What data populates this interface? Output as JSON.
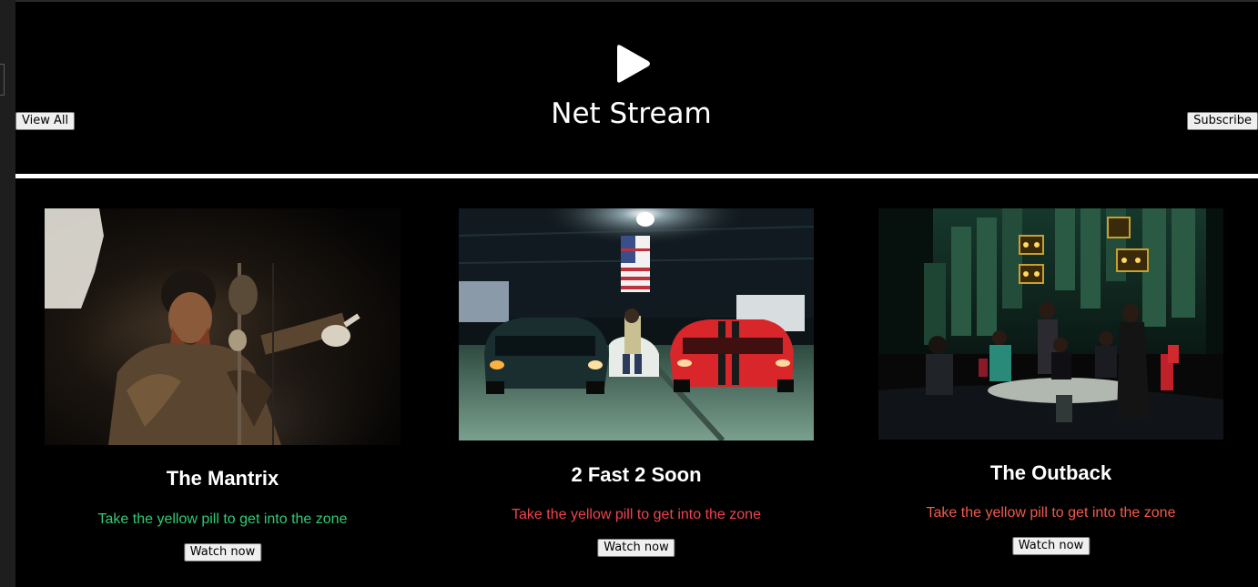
{
  "header": {
    "title": "Net Stream",
    "view_all_label": "View All",
    "subscribe_label": "Subscribe",
    "logo_icon": "play-icon"
  },
  "colors": {
    "background": "#000000",
    "text": "#ffffff",
    "desc_green": "#2ecc71",
    "desc_red": "#f0434f",
    "desc_orange": "#f05a4a"
  },
  "movies": [
    {
      "title": "The Mantrix",
      "description": "Take the yellow pill to get into the zone",
      "button_label": "Watch now",
      "desc_color": "#2ecc71"
    },
    {
      "title": "2 Fast 2 Soon",
      "description": "Take the yellow pill to get into the zone",
      "button_label": "Watch now",
      "desc_color": "#f0434f"
    },
    {
      "title": "The Outback",
      "description": "Take the yellow pill to get into the zone",
      "button_label": "Watch now",
      "desc_color": "#f05a4a"
    }
  ]
}
